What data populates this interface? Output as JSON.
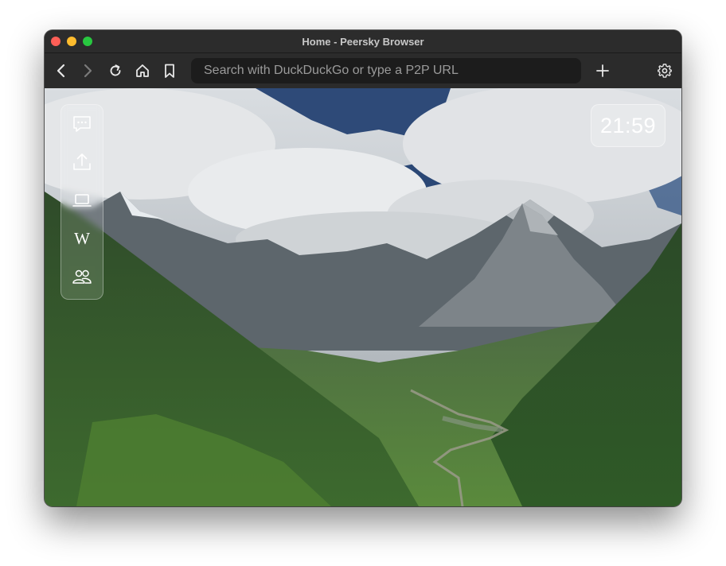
{
  "window": {
    "title": "Home - Peersky Browser"
  },
  "toolbar": {
    "back_icon": "chevron-left-icon",
    "forward_icon": "chevron-right-icon",
    "reload_icon": "reload-icon",
    "home_icon": "home-icon",
    "bookmark_icon": "bookmark-icon",
    "search_placeholder": "Search with DuckDuckGo or type a P2P URL",
    "new_tab_icon": "plus-icon",
    "settings_icon": "gear-icon"
  },
  "sidebar": {
    "items": [
      {
        "icon": "chat-bubble-icon"
      },
      {
        "icon": "upload-icon"
      },
      {
        "icon": "laptop-icon"
      },
      {
        "icon": "wikipedia-icon",
        "glyph": "W"
      },
      {
        "icon": "people-icon"
      }
    ]
  },
  "clock": {
    "time": "21:59"
  },
  "background": {
    "description_colors": {
      "sky": "#c9ced3",
      "forest": "#3a5c2a"
    }
  }
}
